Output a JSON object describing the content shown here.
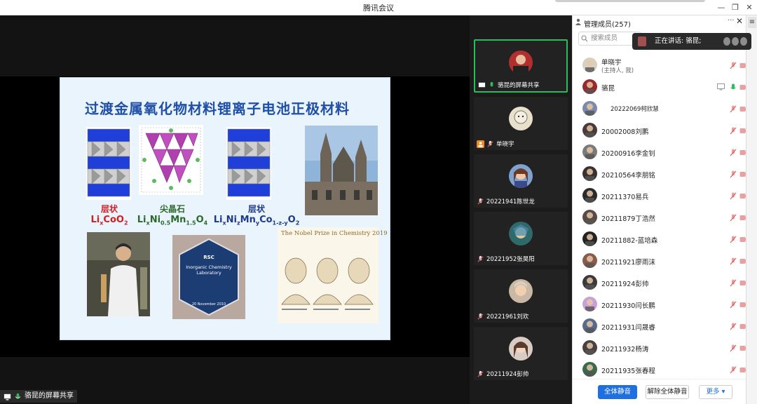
{
  "window": {
    "title": "腾讯会议",
    "minimize": "—",
    "restore": "❐",
    "close": "✕"
  },
  "slide": {
    "title": "过渡金属氧化物材料锂离子电池正极材料",
    "crystal1_label": "层状",
    "crystal2_label": "尖晶石",
    "crystal3_label": "层状",
    "nobel_title": "The Nobel Prize in Chemistry 2019",
    "plaque_lines": [
      "RSC",
      "Inorganic Chemistry",
      "Laboratory",
      "20 November 2010"
    ]
  },
  "share_status": "骆昆的屏幕共享",
  "videos": [
    {
      "name": "骆昆的屏幕共享",
      "active": true
    },
    {
      "name": "单晓宇",
      "active": false
    },
    {
      "name": "20221941陈世龙",
      "active": false
    },
    {
      "name": "20221952张昊阳",
      "active": false
    },
    {
      "name": "20221961刘欢",
      "active": false
    },
    {
      "name": "20211924彭帅",
      "active": false
    }
  ],
  "panel": {
    "title": "管理成员(257)",
    "more": "···",
    "close": "✕",
    "search_placeholder": "搜索成员",
    "speaking": "正在讲话: 骆昆;",
    "members": [
      {
        "name": "单晓宇",
        "sub": "(主持人, 我)"
      },
      {
        "name": "骆昆",
        "sub": ""
      },
      {
        "name": "20222069柯欣慧",
        "sub": ""
      },
      {
        "name": "20002008刘鹏",
        "sub": ""
      },
      {
        "name": "20200916李金钊",
        "sub": ""
      },
      {
        "name": "20210564李朋铭",
        "sub": ""
      },
      {
        "name": "20211370易兵",
        "sub": ""
      },
      {
        "name": "20211879丁浩然",
        "sub": ""
      },
      {
        "name": "20211882-蓝培森",
        "sub": ""
      },
      {
        "name": "20211921廖雨沫",
        "sub": ""
      },
      {
        "name": "20211924彭帅",
        "sub": ""
      },
      {
        "name": "20211930闫长鹏",
        "sub": ""
      },
      {
        "name": "20211931闫晟睿",
        "sub": ""
      },
      {
        "name": "20211932杨涛",
        "sub": ""
      },
      {
        "name": "20211935张春程",
        "sub": ""
      }
    ],
    "mute_all": "全体静音",
    "unmute_all": "解除全体静音",
    "more_label": "更多 ▾"
  },
  "edge_menu": "≡",
  "colors": {
    "accent": "#1f6fe0",
    "active_green": "#2dbb5c",
    "muted_red": "#e05a5a"
  }
}
